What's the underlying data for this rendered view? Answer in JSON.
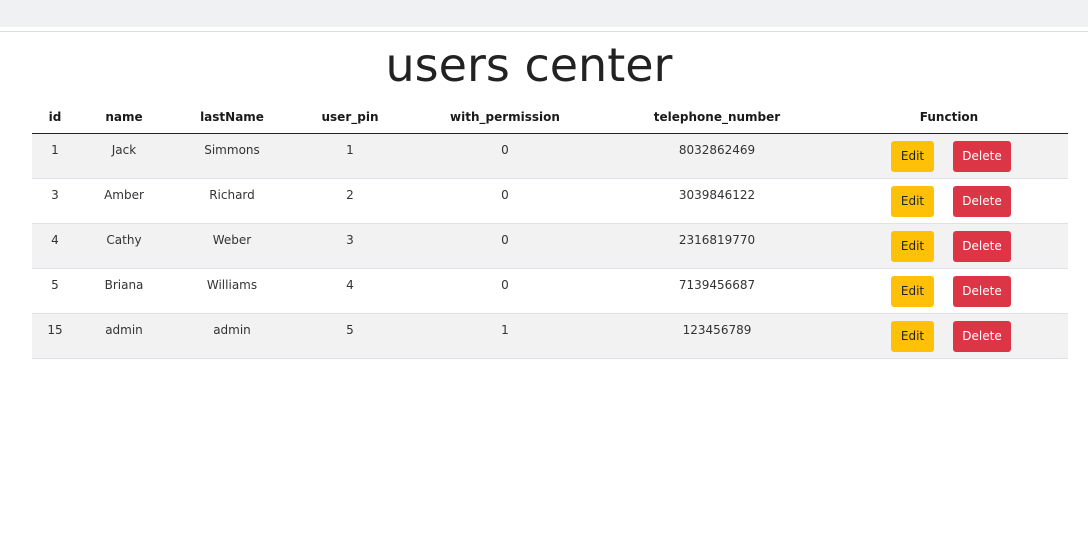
{
  "page": {
    "title": "users center"
  },
  "table": {
    "columns": [
      "id",
      "name",
      "lastName",
      "user_pin",
      "with_permission",
      "telephone_number",
      "Function"
    ],
    "rows": [
      {
        "id": "1",
        "name": "Jack",
        "lastName": "Simmons",
        "user_pin": "1",
        "with_permission": "0",
        "telephone_number": "8032862469"
      },
      {
        "id": "3",
        "name": "Amber",
        "lastName": "Richard",
        "user_pin": "2",
        "with_permission": "0",
        "telephone_number": "3039846122"
      },
      {
        "id": "4",
        "name": "Cathy",
        "lastName": "Weber",
        "user_pin": "3",
        "with_permission": "0",
        "telephone_number": "2316819770"
      },
      {
        "id": "5",
        "name": "Briana",
        "lastName": "Williams",
        "user_pin": "4",
        "with_permission": "0",
        "telephone_number": "7139456687"
      },
      {
        "id": "15",
        "name": "admin",
        "lastName": "admin",
        "user_pin": "5",
        "with_permission": "1",
        "telephone_number": "123456789"
      }
    ],
    "edit_label": "Edit",
    "delete_label": "Delete"
  },
  "colors": {
    "edit_button": "#ffc107",
    "delete_button": "#dc3545",
    "stripe": "#f2f2f2"
  }
}
